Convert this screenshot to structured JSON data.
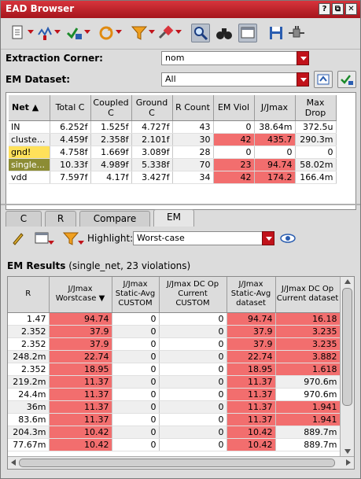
{
  "window": {
    "title": "EAD Browser",
    "controls": [
      "?",
      "⧉",
      "✕"
    ]
  },
  "toolbar": {
    "icons": [
      "new-document-icon",
      "network-icon",
      "check-filter-icon",
      "refresh-icon",
      "filter-icon",
      "probe-icon",
      "zoom-icon",
      "binoculars-icon",
      "view-icon",
      "save-icon",
      "connect-icon"
    ]
  },
  "extraction_corner": {
    "label": "Extraction Corner:",
    "value": "nom"
  },
  "em_dataset": {
    "label": "EM Dataset:",
    "value": "All"
  },
  "net_table": {
    "columns": [
      "Net",
      "Total C",
      "Coupled C",
      "Ground C",
      "R Count",
      "EM Viol",
      "J/Jmax",
      "Max Drop"
    ],
    "rows": [
      {
        "net": "IN",
        "total": "6.252f",
        "coupled": "1.525f",
        "ground": "4.727f",
        "rcount": "43",
        "emviol": "0",
        "jjmax": "38.64m",
        "maxdrop": "372.5u",
        "hl": ""
      },
      {
        "net": "cluste...",
        "total": "4.459f",
        "coupled": "2.358f",
        "ground": "2.101f",
        "rcount": "30",
        "emviol": "42",
        "jjmax": "435.7",
        "maxdrop": "290.3m",
        "hl": "red"
      },
      {
        "net": "gnd!",
        "total": "4.758f",
        "coupled": "1.669f",
        "ground": "3.089f",
        "rcount": "28",
        "emviol": "0",
        "jjmax": "0",
        "maxdrop": "0",
        "hl": "yellow"
      },
      {
        "net": "single...",
        "total": "10.33f",
        "coupled": "4.989f",
        "ground": "5.338f",
        "rcount": "70",
        "emviol": "23",
        "jjmax": "94.74",
        "maxdrop": "58.02m",
        "hl": "red-olive"
      },
      {
        "net": "vdd",
        "total": "7.597f",
        "coupled": "4.17f",
        "ground": "3.427f",
        "rcount": "34",
        "emviol": "42",
        "jjmax": "174.2",
        "maxdrop": "166.4m",
        "hl": "red"
      }
    ]
  },
  "tabs": [
    "C",
    "R",
    "Compare",
    "EM"
  ],
  "active_tab": "EM",
  "highlight": {
    "label": "Highlight:",
    "value": "Worst-case"
  },
  "em_results": {
    "title": "EM Results",
    "subtitle": "(single_net, 23 violations)",
    "columns": [
      "R",
      "J/Jmax Worstcase",
      "J/Jmax Static-Avg CUSTOM",
      "J/Jmax DC Op Current CUSTOM",
      "J/Jmax Static-Avg dataset",
      "J/Jmax DC Op Current dataset"
    ],
    "rows": [
      [
        "1.47",
        "94.74",
        "0",
        "0",
        "94.74",
        "16.18"
      ],
      [
        "2.352",
        "37.9",
        "0",
        "0",
        "37.9",
        "3.235"
      ],
      [
        "2.352",
        "37.9",
        "0",
        "0",
        "37.9",
        "3.235"
      ],
      [
        "248.2m",
        "22.74",
        "0",
        "0",
        "22.74",
        "3.882"
      ],
      [
        "2.352",
        "18.95",
        "0",
        "0",
        "18.95",
        "1.618"
      ],
      [
        "219.2m",
        "11.37",
        "0",
        "0",
        "11.37",
        "970.6m"
      ],
      [
        "24.4m",
        "11.37",
        "0",
        "0",
        "11.37",
        "970.6m"
      ],
      [
        "36m",
        "11.37",
        "0",
        "0",
        "11.37",
        "1.941"
      ],
      [
        "83.6m",
        "11.37",
        "0",
        "0",
        "11.37",
        "1.941"
      ],
      [
        "204.3m",
        "10.42",
        "0",
        "0",
        "10.42",
        "889.7m"
      ],
      [
        "77.67m",
        "10.42",
        "0",
        "0",
        "10.42",
        "889.7m"
      ]
    ],
    "red_last": [
      true,
      true,
      true,
      true,
      true,
      false,
      false,
      true,
      true,
      false,
      false
    ]
  },
  "colors": {
    "title_red": "#c1121a",
    "violation_red": "#f26e6e",
    "highlight_yellow": "#ffe15a",
    "selected_olive": "#8c8c34"
  }
}
